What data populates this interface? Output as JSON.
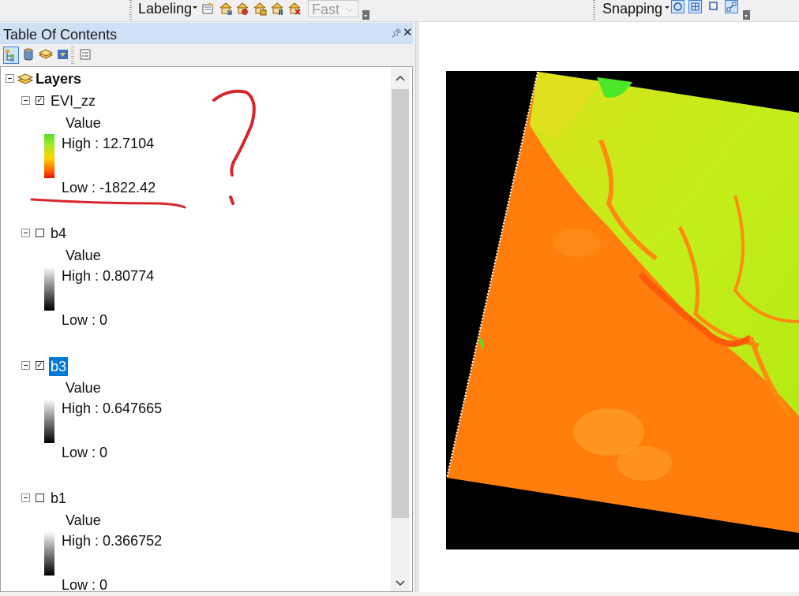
{
  "toolbar": {
    "labeling_label": "Labeling",
    "quality_value": "Fast",
    "snapping_label": "Snapping"
  },
  "toc": {
    "title": "Table Of Contents",
    "root_label": "Layers",
    "layers": [
      {
        "name": "EVI_zz",
        "checked": true,
        "selected": false,
        "value_label": "Value",
        "high": "High : 12.7104",
        "low": "Low : -1822.42",
        "ramp": "color"
      },
      {
        "name": "b4",
        "checked": false,
        "selected": false,
        "value_label": "Value",
        "high": "High : 0.80774",
        "low": "Low : 0",
        "ramp": "gray"
      },
      {
        "name": "b3",
        "checked": true,
        "selected": true,
        "value_label": "Value",
        "high": "High : 0.647665",
        "low": "Low : 0",
        "ramp": "gray"
      },
      {
        "name": "b1",
        "checked": false,
        "selected": false,
        "value_label": "Value",
        "high": "High : 0.366752",
        "low": "Low : 0",
        "ramp": "gray"
      }
    ]
  },
  "colors": {
    "selection": "#0078d7",
    "annotation": "#d8262d",
    "map_background": "#000000"
  }
}
